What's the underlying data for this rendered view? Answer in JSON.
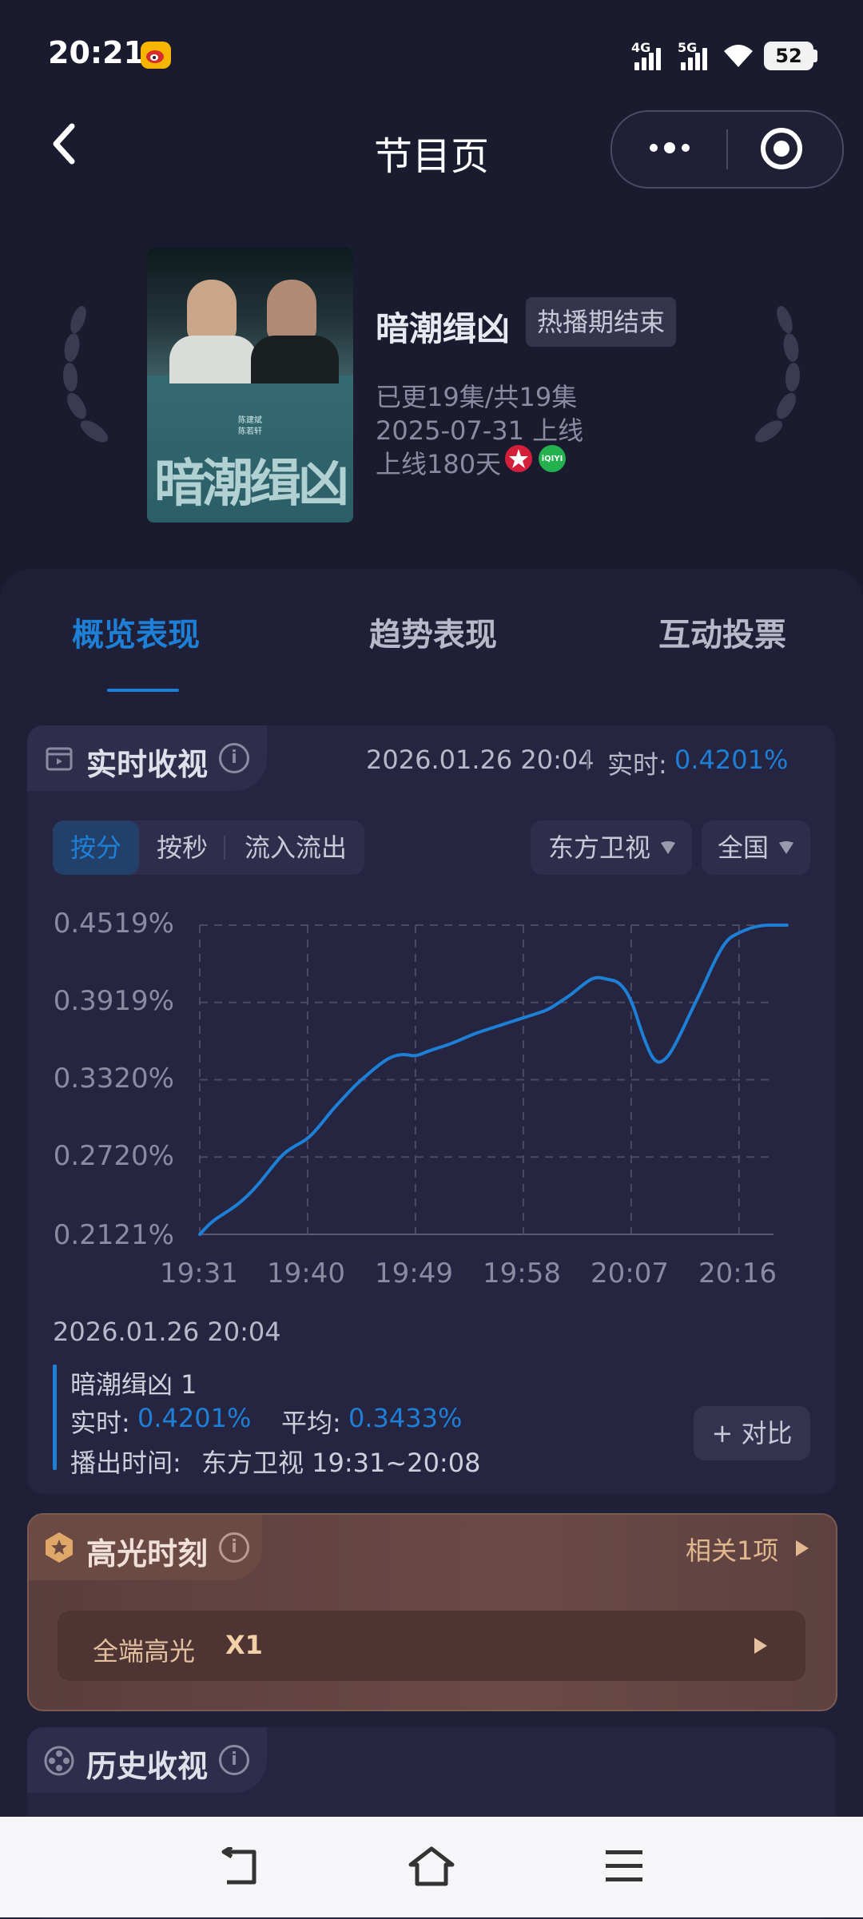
{
  "status_bar": {
    "time": "20:21",
    "net1": "4G",
    "net2": "5G",
    "battery": "52"
  },
  "nav": {
    "title": "节目页"
  },
  "show": {
    "title": "暗潮缉凶",
    "status_tag": "热播期结束",
    "episodes": "已更19集/共19集",
    "premiere": "2025-07-31 上线",
    "days_online": "上线180天",
    "poster_title": "暗潮缉凶",
    "poster_credits": [
      "陈建斌",
      "陈若轩"
    ],
    "platform2": "iQIYI"
  },
  "tabs": [
    "概览表现",
    "趋势表现",
    "互动投票"
  ],
  "realtime": {
    "title": "实时收视",
    "timestamp": "2026.01.26 20:04",
    "rt_label": "实时:",
    "rt_value": "0.4201%",
    "modes": [
      "按分",
      "按秒",
      "流入流出"
    ],
    "channel": "东方卫视",
    "region": "全国"
  },
  "chart_data": {
    "type": "line",
    "title": "",
    "xlabel": "",
    "ylabel": "",
    "x_ticks": [
      "19:31",
      "19:40",
      "19:49",
      "19:58",
      "20:07",
      "20:16"
    ],
    "y_ticks": [
      "0.4519%",
      "0.3919%",
      "0.3320%",
      "0.2720%",
      "0.2121%"
    ],
    "ylim": [
      0.2121,
      0.4519
    ],
    "grid": true,
    "series": [
      {
        "name": "暗潮缉凶 1",
        "x": [
          "19:31",
          "19:32",
          "19:33",
          "19:34",
          "19:35",
          "19:36",
          "19:37",
          "19:38",
          "19:39",
          "19:40",
          "19:41",
          "19:42",
          "19:43",
          "19:44",
          "19:45",
          "19:46",
          "19:47",
          "19:48",
          "19:49",
          "19:50",
          "19:51",
          "19:52",
          "19:53",
          "19:54",
          "19:55",
          "19:56",
          "19:57",
          "19:58",
          "19:59",
          "20:00",
          "20:01",
          "20:02",
          "20:03",
          "20:04",
          "20:05",
          "20:06",
          "20:07",
          "20:08",
          "20:09",
          "20:10",
          "20:11",
          "20:12",
          "20:13",
          "20:14",
          "20:15",
          "20:16",
          "20:17",
          "20:18",
          "20:19",
          "20:20"
        ],
        "values": [
          0.2121,
          0.222,
          0.228,
          0.234,
          0.242,
          0.252,
          0.264,
          0.275,
          0.281,
          0.286,
          0.296,
          0.308,
          0.318,
          0.328,
          0.336,
          0.344,
          0.35,
          0.352,
          0.35,
          0.354,
          0.357,
          0.36,
          0.364,
          0.368,
          0.371,
          0.374,
          0.377,
          0.38,
          0.383,
          0.386,
          0.392,
          0.398,
          0.406,
          0.412,
          0.41,
          0.408,
          0.395,
          0.365,
          0.344,
          0.348,
          0.365,
          0.385,
          0.404,
          0.425,
          0.441,
          0.446,
          0.45,
          0.4519,
          0.4519,
          0.4519
        ]
      }
    ]
  },
  "legend": {
    "date": "2026.01.26 20:04",
    "series_name": "暗潮缉凶 1",
    "rt_label": "实时:",
    "rt_value": "0.4201%",
    "avg_label": "平均:",
    "avg_value": "0.3433%",
    "air_label": "播出时间:",
    "air_value": "东方卫视 19:31~20:08",
    "compare": "+ 对比"
  },
  "highlight": {
    "title": "高光时刻",
    "related": "相关1项",
    "row_label": "全端高光",
    "row_value": "X1"
  },
  "history": {
    "title": "历史收视"
  }
}
